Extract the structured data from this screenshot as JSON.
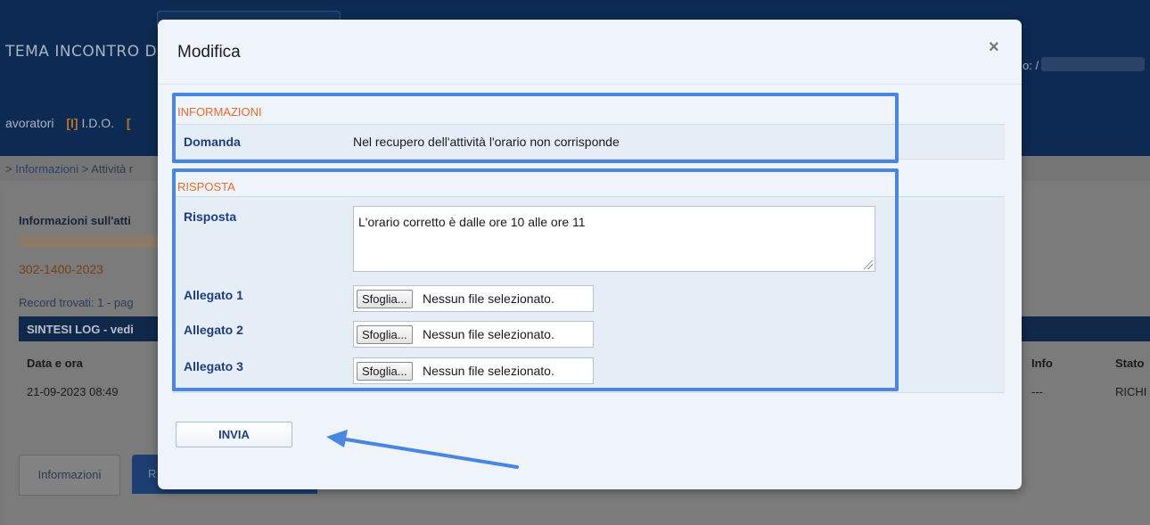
{
  "background": {
    "app_title": "TEMA INCONTRO D",
    "user_label": "o: /",
    "nav": {
      "lavoratori": "avoratori",
      "ido_tag": "[I]",
      "ido_label": "I.D.O.",
      "extra_tag": "["
    },
    "breadcrumb": {
      "sep1": ">",
      "informazioni": "Informazioni",
      "sep2": ">",
      "attivita": "Attività r"
    },
    "info_title": "Informazioni sull'atti",
    "code": "302-1400-2023",
    "records": "Record trovati: 1 - pag",
    "table_title": "SINTESI LOG - vedi",
    "columns": {
      "data_ora": "Data e ora",
      "info": "Info",
      "stato": "Stato"
    },
    "row": {
      "data_ora": "21-09-2023 08:49",
      "info": "---",
      "stato": "RICHI"
    },
    "tabs": {
      "informazioni": "Informazioni",
      "second": "R"
    }
  },
  "modal": {
    "title": "Modifica",
    "close_glyph": "×",
    "informazioni": {
      "section_label": "INFORMAZIONI",
      "domanda_label": "Domanda",
      "domanda_value": "Nel recupero dell'attività l'orario non corrisponde"
    },
    "risposta": {
      "section_label": "RISPOSTA",
      "risposta_label": "Risposta",
      "risposta_value": "L'orario corretto è dalle ore 10 alle ore 11",
      "attachments": [
        {
          "label": "Allegato 1",
          "button": "Sfoglia...",
          "status": "Nessun file selezionato."
        },
        {
          "label": "Allegato 2",
          "button": "Sfoglia...",
          "status": "Nessun file selezionato."
        },
        {
          "label": "Allegato 3",
          "button": "Sfoglia...",
          "status": "Nessun file selezionato."
        }
      ]
    },
    "submit_label": "INVIA"
  },
  "colors": {
    "header_bg": "#0c2a52",
    "section_label": "#e46b2c",
    "field_label": "#1f3d7a",
    "highlight": "#4a86e0"
  }
}
